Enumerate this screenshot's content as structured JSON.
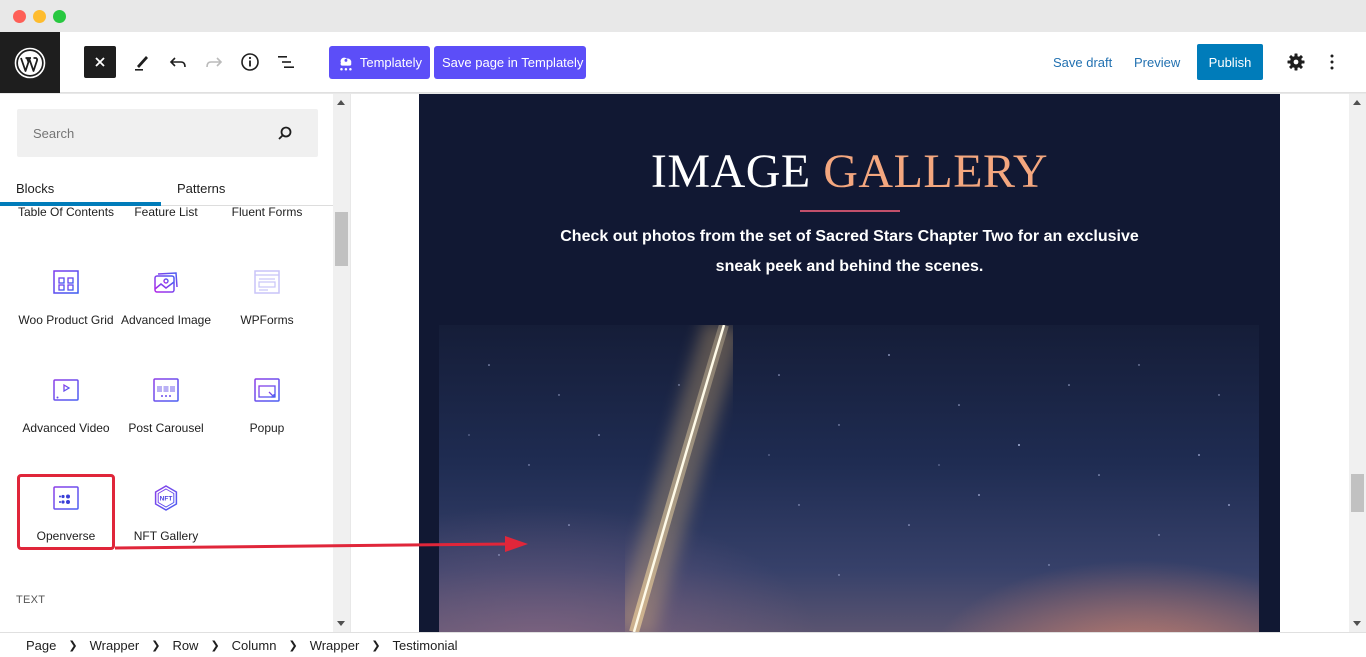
{
  "window": {
    "controls": [
      "close",
      "minimize",
      "maximize"
    ]
  },
  "toolbar": {
    "logo": "wordpress-logo",
    "close_label": "Close",
    "tools": [
      "close-icon",
      "edit-pencil-icon",
      "undo-icon",
      "redo-icon",
      "info-icon",
      "list-view-icon"
    ],
    "templately_label": "Templately",
    "save_templately_label": "Save page in Templately",
    "save_draft_label": "Save draft",
    "preview_label": "Preview",
    "publish_label": "Publish",
    "accent_purple": "#5c4ef8",
    "accent_blue": "#007cba"
  },
  "sidebar": {
    "search": {
      "placeholder": "Search",
      "value": ""
    },
    "tabs": [
      {
        "label": "Blocks",
        "active": true
      },
      {
        "label": "Patterns",
        "active": false
      }
    ],
    "blocks": [
      {
        "label": "Table Of Contents",
        "icon": "table-of-contents-icon"
      },
      {
        "label": "Feature List",
        "icon": "feature-list-icon"
      },
      {
        "label": "Fluent Forms",
        "icon": "fluent-forms-icon"
      },
      {
        "label": "Woo Product Grid",
        "icon": "product-grid-icon"
      },
      {
        "label": "Advanced Image",
        "icon": "image-icon"
      },
      {
        "label": "WPForms",
        "icon": "form-icon"
      },
      {
        "label": "Advanced Video",
        "icon": "video-icon"
      },
      {
        "label": "Post Carousel",
        "icon": "carousel-icon"
      },
      {
        "label": "Popup",
        "icon": "popup-icon"
      },
      {
        "label": "Openverse",
        "icon": "openverse-icon",
        "highlighted": true
      },
      {
        "label": "NFT Gallery",
        "icon": "nft-icon"
      }
    ],
    "section_heading": "TEXT"
  },
  "canvas": {
    "title_part1": "IMAGE",
    "title_part2": "GALLERY",
    "subtitle": "Check out photos from the set of Sacred Stars Chapter Two for an exclusive sneak peek and behind the scenes.",
    "hero_image": "rocket-launch-night-sky",
    "background_color": "#111833",
    "title_accent_color": "#f4a77f",
    "divider_color": "#c2506b"
  },
  "annotation": {
    "highlight_color": "#e0263a",
    "description": "arrow from Openverse block to canvas image"
  },
  "breadcrumb": [
    "Page",
    "Wrapper",
    "Row",
    "Column",
    "Wrapper",
    "Testimonial"
  ]
}
